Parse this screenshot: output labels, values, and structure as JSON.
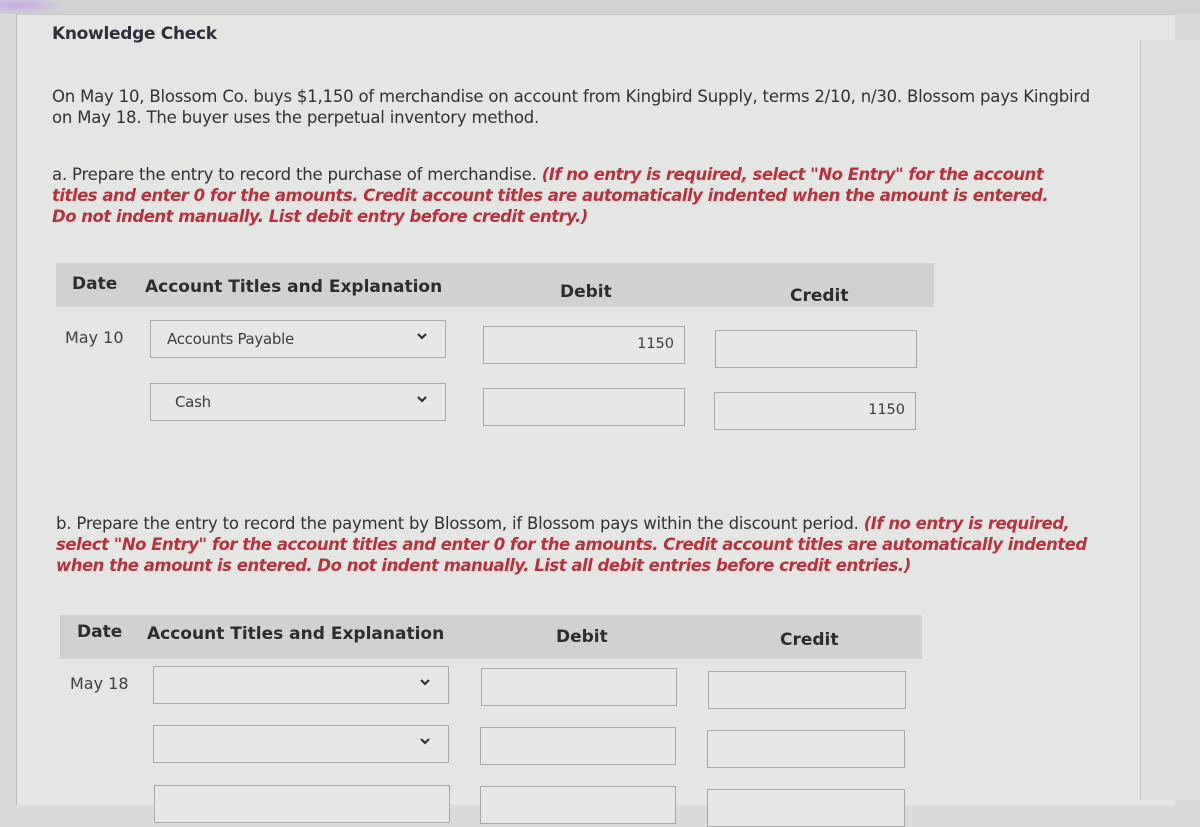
{
  "title": "Knowledge Check",
  "intro": {
    "line1": "On May 10, Blossom Co. buys $1,150 of merchandise on account from Kingbird Supply, terms 2/10, n/30. Blossom pays Kingbird",
    "line2": "on May 18. The buyer uses the perpetual inventory method."
  },
  "part_a": {
    "prompt": "a. Prepare the entry to record the purchase of merchandise.",
    "instruction": "(If no entry is required, select \"No Entry\" for the account titles and enter 0 for the amounts. Credit account titles are automatically indented when the amount is entered. Do not indent manually. List debit entry before credit entry.)",
    "headers": {
      "date": "Date",
      "account": "Account Titles and Explanation",
      "debit": "Debit",
      "credit": "Credit"
    },
    "rows": [
      {
        "date": "May 10",
        "account": "Accounts Payable",
        "debit": "1150",
        "credit": ""
      },
      {
        "date": "",
        "account": "Cash",
        "debit": "",
        "credit": "1150"
      }
    ]
  },
  "part_b": {
    "prompt": "b. Prepare the entry to record the payment by Blossom, if Blossom pays within the discount period.",
    "instruction": "(If no entry is required, select \"No Entry\" for the account titles and enter 0 for the amounts. Credit account titles are automatically indented when the amount is entered. Do not indent manually. List all debit entries before credit entries.)",
    "headers": {
      "date": "Date",
      "account": "Account Titles and Explanation",
      "debit": "Debit",
      "credit": "Credit"
    },
    "rows": [
      {
        "date": "May 18",
        "account": "",
        "debit": "",
        "credit": ""
      },
      {
        "date": "",
        "account": "",
        "debit": "",
        "credit": ""
      },
      {
        "date": "",
        "account": "",
        "debit": "",
        "credit": ""
      }
    ]
  },
  "icons": {
    "dropdown": "chevron-down-icon"
  }
}
